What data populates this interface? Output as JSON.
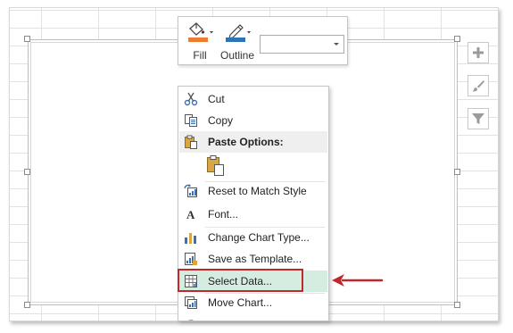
{
  "mini_toolbar": {
    "fill_label": "Fill",
    "outline_label": "Outline",
    "fill_color": "#ed7d31",
    "outline_color": "#2e75b6",
    "dropdown_value": ""
  },
  "side_buttons": {
    "elements_icon": "plus-icon",
    "styles_icon": "brush-icon",
    "filters_icon": "funnel-icon"
  },
  "context_menu": {
    "items": [
      {
        "label": "Cut",
        "icon": "scissors-icon"
      },
      {
        "label": "Copy",
        "icon": "copy-icon"
      },
      {
        "label": "Paste Options:",
        "icon": "paste-icon"
      },
      {
        "label": "Reset to Match Style",
        "icon": "reset-style-icon"
      },
      {
        "label": "Font...",
        "icon": "font-icon"
      },
      {
        "label": "Change Chart Type...",
        "icon": "chart-type-icon"
      },
      {
        "label": "Save as Template...",
        "icon": "template-icon"
      },
      {
        "label": "Select Data...",
        "icon": "select-data-icon"
      },
      {
        "label": "Move Chart...",
        "icon": "move-chart-icon"
      }
    ],
    "selected_label": "Select Data..."
  },
  "annotation": {
    "color": "#c0282a"
  }
}
